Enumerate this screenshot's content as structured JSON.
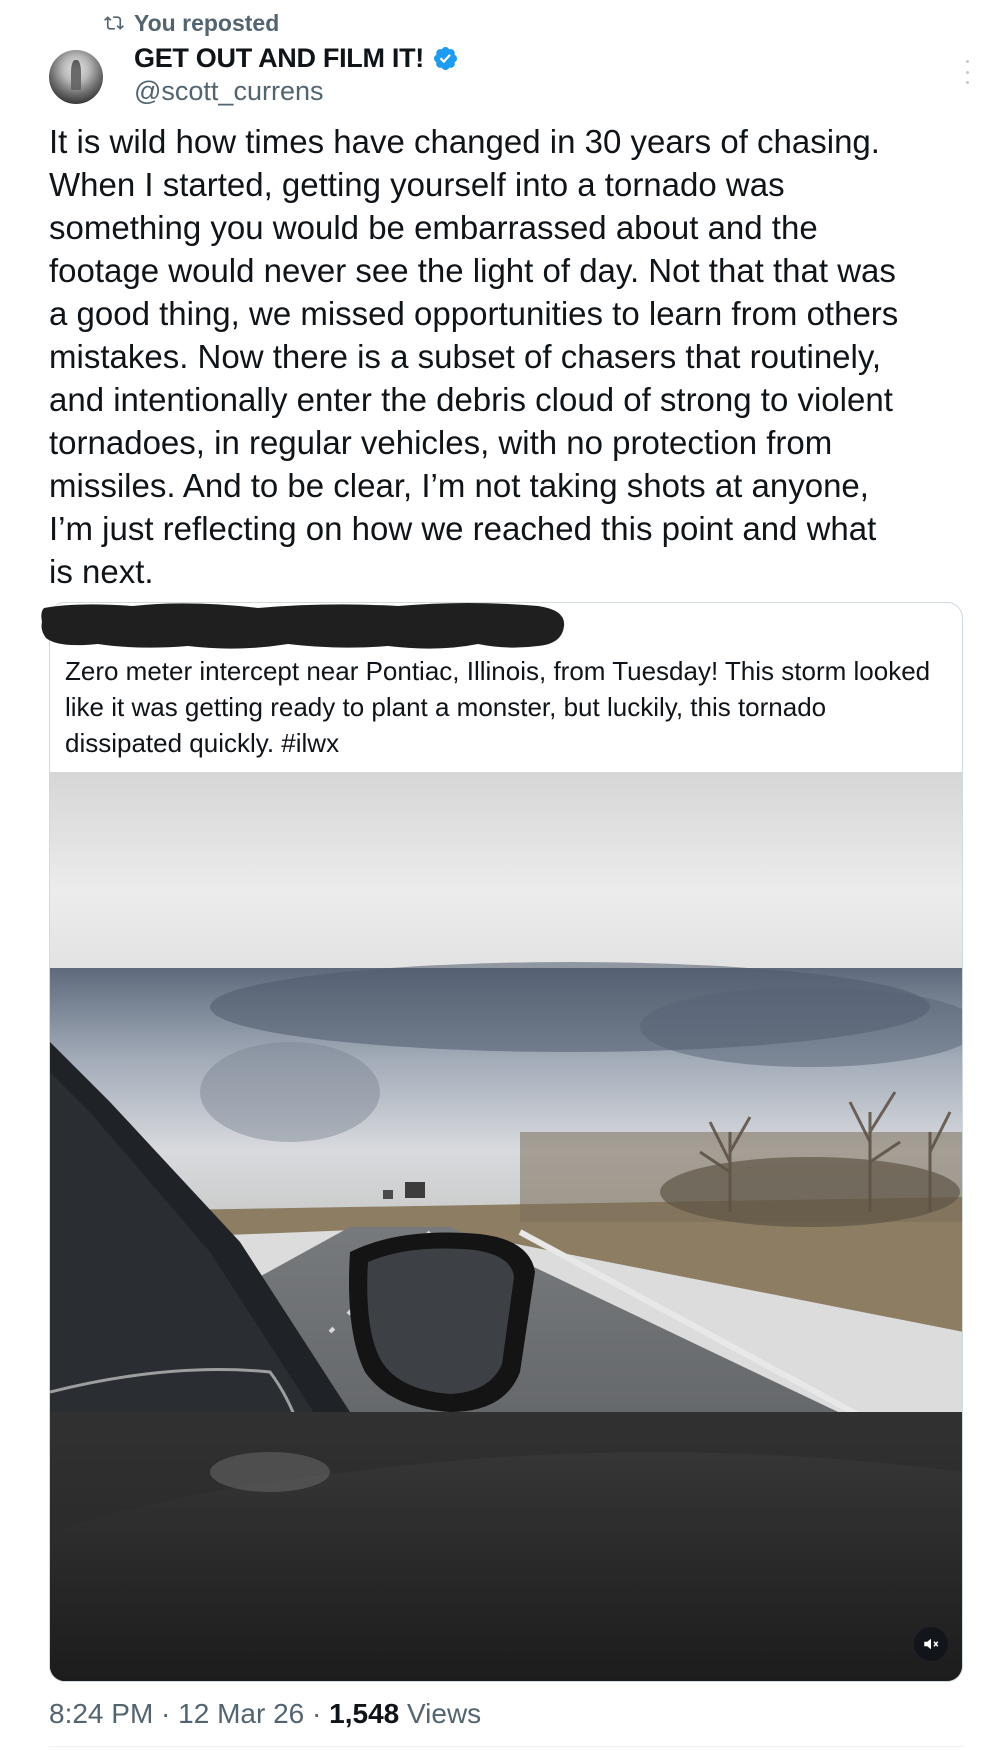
{
  "repost": {
    "label": "You reposted",
    "icon": "repost-icon"
  },
  "author": {
    "display_name": "GET OUT AND FILM IT!",
    "handle": "@scott_currens",
    "verified": true,
    "verified_color": "#1d9bf0"
  },
  "post": {
    "text": "It is wild how times have changed in 30 years of chasing.\nWhen I started, getting yourself into a tornado was\nsomething you would be embarrassed about and the\nfootage would never see the light of day. Not that that was\na good thing, we missed opportunities to learn from others\nmistakes. Now there is a subset of chasers that routinely,\nand intentionally enter the debris cloud of strong to violent\ntornadoes, in regular vehicles, with no protection from\nmissiles. And to be clear, I’m not taking shots at anyone,\nI’m just reflecting on how we reached this point and what\nis next."
  },
  "quote": {
    "header_redacted": true,
    "text": "Zero meter intercept near Pontiac, Illinois, from Tuesday! This storm looked like it was getting ready to plant a monster, but luckily, this tornado dissipated quickly. #ilwx",
    "media": {
      "type": "video",
      "muted": true,
      "mute_icon": "muted-speaker-icon"
    }
  },
  "meta": {
    "time": "8:24 PM",
    "separator": " · ",
    "date": "12 Mar 26",
    "views_count": "1,548",
    "views_label": " Views"
  },
  "colors": {
    "text_primary": "#0f1419",
    "text_secondary": "#536471",
    "border": "#cfd9de",
    "accent": "#1d9bf0"
  }
}
